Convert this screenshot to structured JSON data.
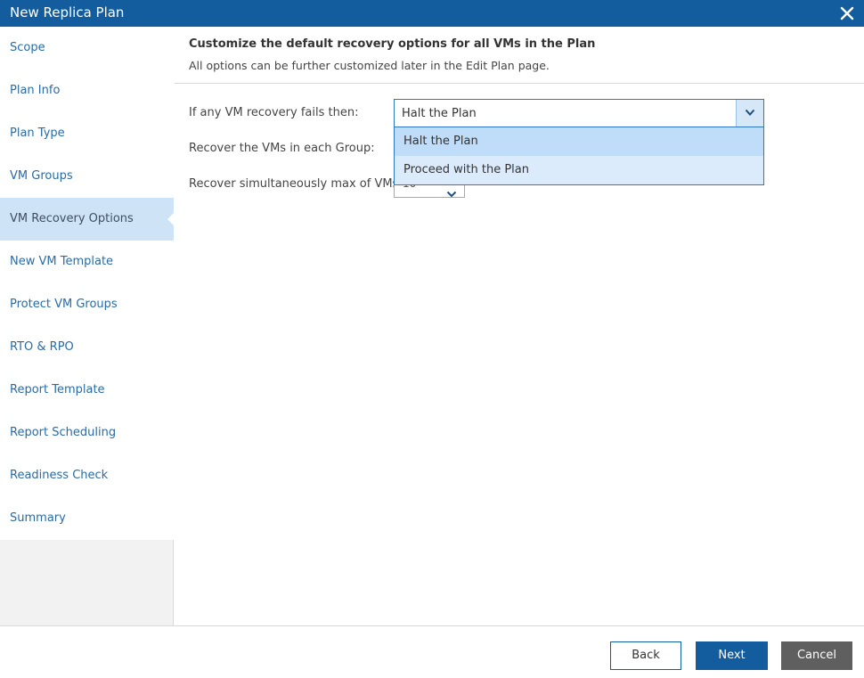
{
  "window": {
    "title": "New Replica Plan"
  },
  "sidebar": {
    "items": [
      {
        "label": "Scope"
      },
      {
        "label": "Plan Info"
      },
      {
        "label": "Plan Type"
      },
      {
        "label": "VM Groups"
      },
      {
        "label": "VM Recovery Options",
        "active": true
      },
      {
        "label": "New VM Template"
      },
      {
        "label": "Protect VM Groups"
      },
      {
        "label": "RTO & RPO"
      },
      {
        "label": "Report Template"
      },
      {
        "label": "Report Scheduling"
      },
      {
        "label": "Readiness Check"
      },
      {
        "label": "Summary"
      }
    ]
  },
  "main": {
    "title": "Customize the default recovery options for all VMs in the Plan",
    "subtitle": "All options can be further customized later in the Edit Plan page.",
    "fields": {
      "on_failure_label": "If any VM recovery fails then:",
      "on_failure_value": "Halt the Plan",
      "on_failure_options": [
        "Halt the Plan",
        "Proceed with the Plan"
      ],
      "group_order_label": "Recover the VMs in each Group:",
      "max_vms_label": "Recover simultaneously max of VMs:",
      "max_vms_value": "10"
    }
  },
  "footer": {
    "back_label": "Back",
    "next_label": "Next",
    "cancel_label": "Cancel"
  },
  "colors": {
    "brand": "#135c9e",
    "active_nav": "#cfe3f7",
    "link": "#2a6ba6"
  },
  "icons": {
    "close": "close-icon",
    "dropdown": "chevron-down-icon"
  }
}
